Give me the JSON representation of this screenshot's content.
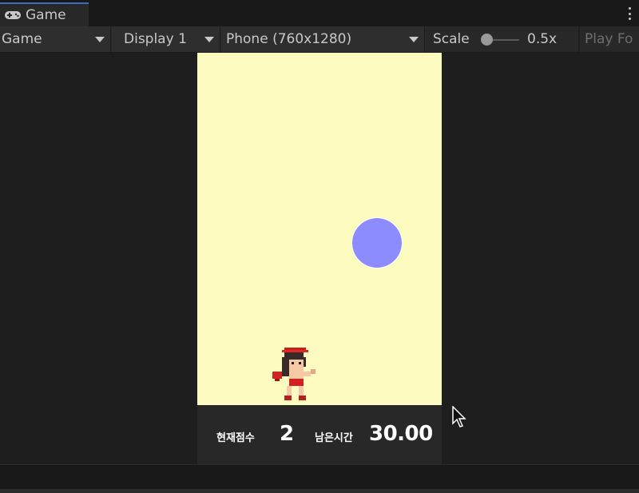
{
  "window": {
    "tab_label": "Game",
    "tab_icon": "gamepad-icon",
    "menu_icon": "kebab-menu-icon"
  },
  "toolbar": {
    "view_mode": "Game",
    "display": "Display 1",
    "resolution": "Phone (760x1280)",
    "scale_label": "Scale",
    "scale_value": "0.5x",
    "scale_level": 0.0,
    "play_focus": "Play Fo"
  },
  "game": {
    "background_color": "#fdfbbf",
    "ball_color": "#8c8cff",
    "hud": {
      "score_label": "현재점수",
      "score_value": "2",
      "time_label": "남은시간",
      "time_value": "30.00"
    }
  },
  "colors": {
    "editor_bg": "#1e1e1e",
    "tab_accent": "#3b6cc1",
    "hud_bg": "#282828"
  }
}
